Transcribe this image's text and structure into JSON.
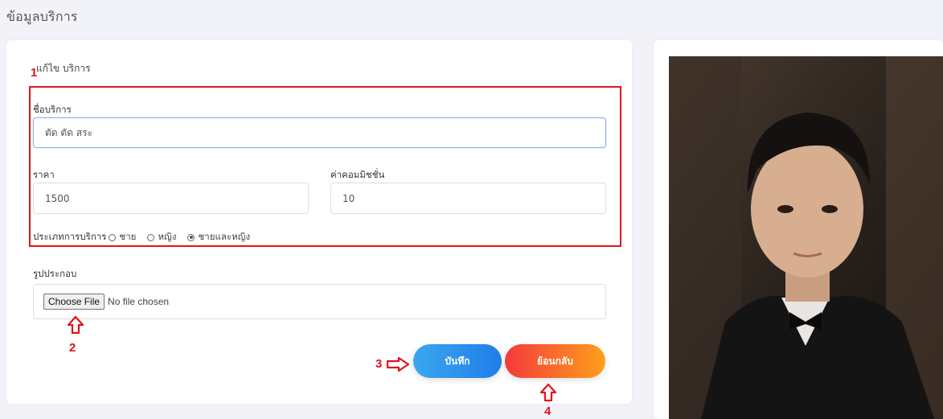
{
  "page": {
    "title": "ข้อมูลบริการ"
  },
  "form": {
    "heading": "แก้ไข บริการ",
    "service_name": {
      "label": "ชื่อบริการ",
      "value": "ตัด ตัด สระ"
    },
    "price": {
      "label": "ราคา",
      "value": "1500"
    },
    "commission": {
      "label": "ค่าคอมมิชชั่น",
      "value": "10"
    },
    "service_type": {
      "label": "ประเภทการบริการ",
      "options": [
        {
          "label": "ชาย",
          "selected": false
        },
        {
          "label": "หญิง",
          "selected": false
        },
        {
          "label": "ชายและหญิง",
          "selected": true
        }
      ]
    },
    "image": {
      "label": "รูปประกอบ",
      "button": "Choose File",
      "status": "No file chosen"
    },
    "save_button": "บันทึก",
    "back_button": "ย้อนกลับ"
  },
  "annotations": {
    "marker_1": "1",
    "marker_2": "2",
    "marker_3": "3",
    "marker_4": "4",
    "color": "#e0131d"
  },
  "preview": {
    "icon": "person-photo"
  }
}
